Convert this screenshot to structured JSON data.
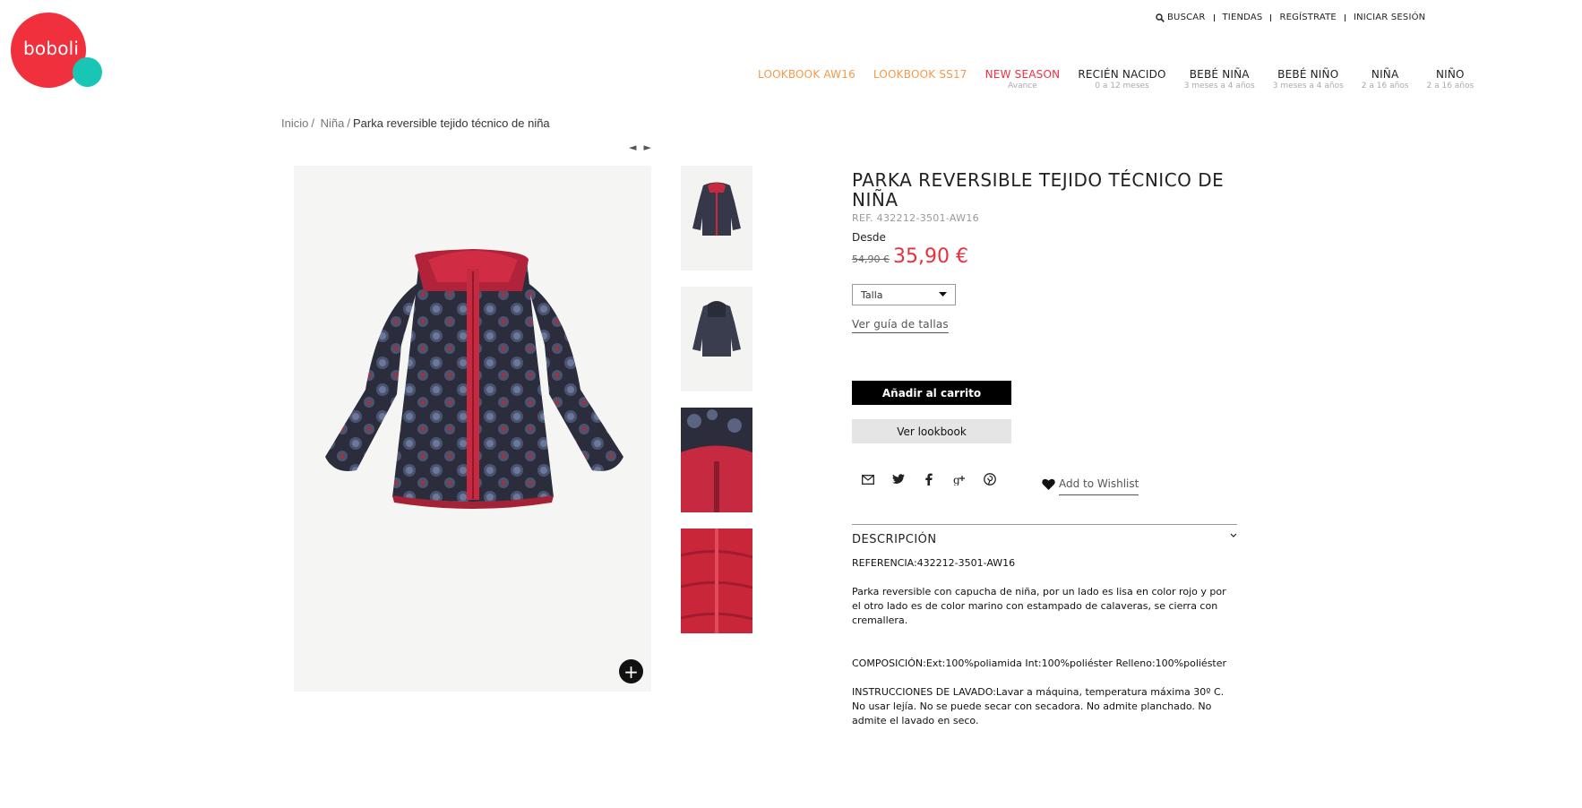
{
  "brand": {
    "name": "boboli"
  },
  "colors": {
    "brand_red": "#f0303d",
    "brand_teal": "#19c6b6",
    "nav_orange": "#f39a4a",
    "price_red": "#e8303d"
  },
  "util_menu": {
    "search": "BUSCAR",
    "stores": "TIENDAS",
    "register": "REGÍSTRATE",
    "login": "INICIAR SESIÓN"
  },
  "nav": {
    "items": [
      {
        "label": "LOOKBOOK AW16",
        "sub": ""
      },
      {
        "label": "LOOKBOOK SS17",
        "sub": ""
      },
      {
        "label": "NEW SEASON",
        "sub": "Avance"
      },
      {
        "label": "RECIÉN NACIDO",
        "sub": "0 a 12 meses"
      },
      {
        "label": "BEBÉ NIÑA",
        "sub": "3 meses a 4 años"
      },
      {
        "label": "BEBÉ NIÑO",
        "sub": "3 meses a 4 años"
      },
      {
        "label": "NIÑA",
        "sub": "2 a 16 años"
      },
      {
        "label": "NIÑO",
        "sub": "2 a 16 años"
      }
    ]
  },
  "breadcrumb": {
    "home": "Inicio",
    "category": "Niña",
    "current": "Parka reversible tejido técnico de niña",
    "separator": "/"
  },
  "pager": {
    "prev": "◄",
    "next": "►"
  },
  "product": {
    "title": "PARKA REVERSIBLE TEJIDO TÉCNICO DE NIÑA",
    "ref": "REF. 432212-3501-AW16",
    "from_label": "Desde",
    "old_price": "54,90 €",
    "price": "35,90 €",
    "size_select": "Talla",
    "size_guide": "Ver guía de tallas",
    "add_to_cart": "Añadir al carrito",
    "lookbook": "Ver lookbook",
    "wishlist": "Add to Wishlist",
    "zoom": "+"
  },
  "description": {
    "heading": "DESCRIPCIÓN",
    "reference": "REFERENCIA:432212-3501-AW16",
    "text": "Parka reversible con capucha de niña, por un lado es lisa en color rojo y por el otro lado es de color marino con estampado de calaveras, se cierra con cremallera.",
    "composition": "COMPOSICIÓN:Ext:100%poliamida Int:100%poliéster Relleno:100%poliéster",
    "washing": "INSTRUCCIONES DE LAVADO:Lavar a máquina, temperatura máxima 30º C. No usar lejía. No se puede secar con secadora. No admite planchado. No admite el lavado en seco."
  },
  "icons": {
    "share": [
      "mail-icon",
      "twitter-icon",
      "facebook-icon",
      "google-plus-icon",
      "pinterest-icon"
    ],
    "wishlist": "heart-icon",
    "search": "search-icon",
    "select": "chevron-down-icon",
    "description_toggle": "chevron-down-icon"
  }
}
